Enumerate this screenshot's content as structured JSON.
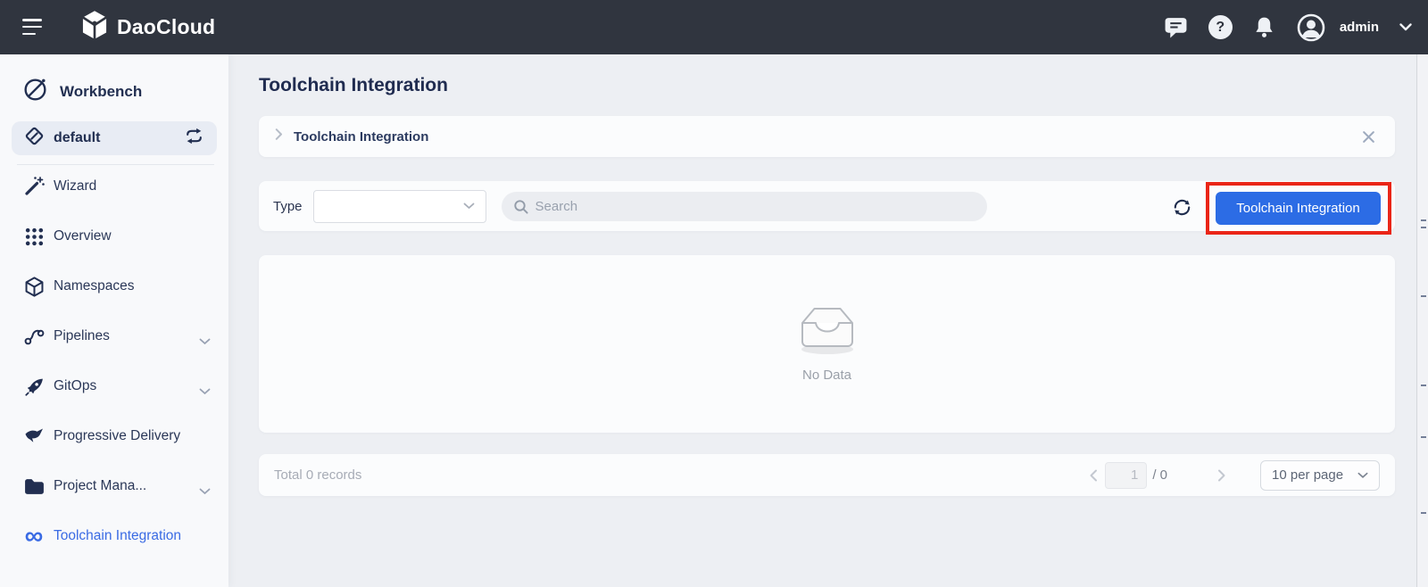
{
  "header": {
    "brand": "DaoCloud",
    "user": {
      "name": "admin"
    },
    "icons": [
      "menu-icon",
      "logo-cube-icon",
      "chat-icon",
      "help-icon",
      "bell-icon",
      "avatar-icon",
      "chevron-down-icon"
    ]
  },
  "sidebar": {
    "section": {
      "label": "Workbench",
      "icon": "workbench-icon"
    },
    "workspace": {
      "label": "default",
      "icon": "workspace-icon",
      "action_icon": "switch-workspace-icon"
    },
    "items": [
      {
        "label": "Wizard",
        "icon": "wand-icon"
      },
      {
        "label": "Overview",
        "icon": "grid-dots-icon"
      },
      {
        "label": "Namespaces",
        "icon": "cube-icon"
      },
      {
        "label": "Pipelines",
        "icon": "pipeline-icon",
        "expandable": true
      },
      {
        "label": "GitOps",
        "icon": "rocket-icon",
        "expandable": true
      },
      {
        "label": "Progressive Delivery",
        "icon": "bird-icon"
      },
      {
        "label": "Project Mana...",
        "icon": "folder-icon",
        "expandable": true
      },
      {
        "label": "Toolchain Integration",
        "icon": "infinity-icon",
        "active": true
      }
    ]
  },
  "main": {
    "title": "Toolchain Integration",
    "breadcrumb": {
      "item": "Toolchain Integration"
    },
    "toolbar": {
      "type_label": "Type",
      "type_value": "",
      "search_placeholder": "Search",
      "refresh_icon": "refresh-icon",
      "action_button": "Toolchain Integration"
    },
    "empty_state": {
      "text": "No Data",
      "icon": "empty-tray-icon"
    },
    "pagination": {
      "total_text": "Total 0 records",
      "current_page": "1",
      "page_divider": "/ 0",
      "per_page": "10 per page"
    }
  },
  "annotation": {
    "highlight_color": "#ea2517"
  },
  "colors": {
    "header_bg": "#30353f",
    "button_blue": "#2c6ce5",
    "active_link_blue": "#3a6be4",
    "page_bg": "#edeff3",
    "sidebar_bg": "#f8f9fb"
  }
}
